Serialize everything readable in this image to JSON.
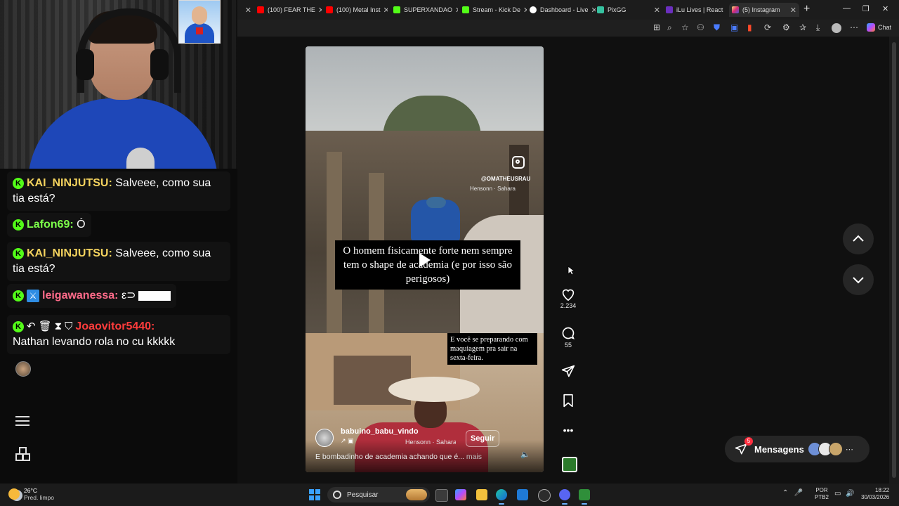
{
  "chat": {
    "messages": [
      {
        "user": "KAI_NINJUTSU:",
        "text": " Salveee, como sua tia está?"
      },
      {
        "user": "Lafon69:",
        "text": " Ó"
      },
      {
        "user": "KAI_NINJUTSU:",
        "text": " Salveee, como sua tia está?"
      },
      {
        "user": "leigawanessa:",
        "text": " ε⊃"
      },
      {
        "user": "Joaovitor5440:",
        "text": "Nathan levando rola no cu kkkkk"
      }
    ],
    "badge_letter": "K"
  },
  "browser": {
    "tabs": [
      {
        "label": "(100) FEAR THE",
        "color": "#ff0000"
      },
      {
        "label": "(100) Metal Inst",
        "color": "#ff0000"
      },
      {
        "label": "SUPERXANDAO",
        "color": "#53fc18"
      },
      {
        "label": "Stream - Kick De",
        "color": "#53fc18"
      },
      {
        "label": "Dashboard - Live",
        "color": "#ffffff"
      },
      {
        "label": "PixGG",
        "color": "#36c2a0"
      },
      {
        "label": "iLu Lives | React",
        "color": "#6b2fbf"
      },
      {
        "label": "(5) Instagram",
        "color": "#e1306c"
      }
    ],
    "chat_label": "Chat"
  },
  "reel": {
    "watermark_handle": "@OMATHEUSRAU",
    "watermark_audio": "Hensonn · Sahara",
    "caption_main": "O homem fisicamente forte nem sempre tem o shape de academia (e por isso são perigosos)",
    "caption_sub": "E você se preparando com maquiagem pra sair na sexta-feira.",
    "author": "babuino_babu_vindo",
    "audio": "Hensonn · Sahara",
    "follow_label": "Seguir",
    "post_caption": "E bombadinho de academia achando que é...",
    "more_label": " mais"
  },
  "actions": {
    "likes": "2.234",
    "comments": "55"
  },
  "messages": {
    "label": "Mensagens",
    "badge": "5"
  },
  "taskbar": {
    "temp": "26°C",
    "condition": "Pred. limpo",
    "search_placeholder": "Pesquisar",
    "lang_top": "POR",
    "lang_bottom": "PTB2",
    "time": "18:22",
    "date": "30/03/2026"
  }
}
